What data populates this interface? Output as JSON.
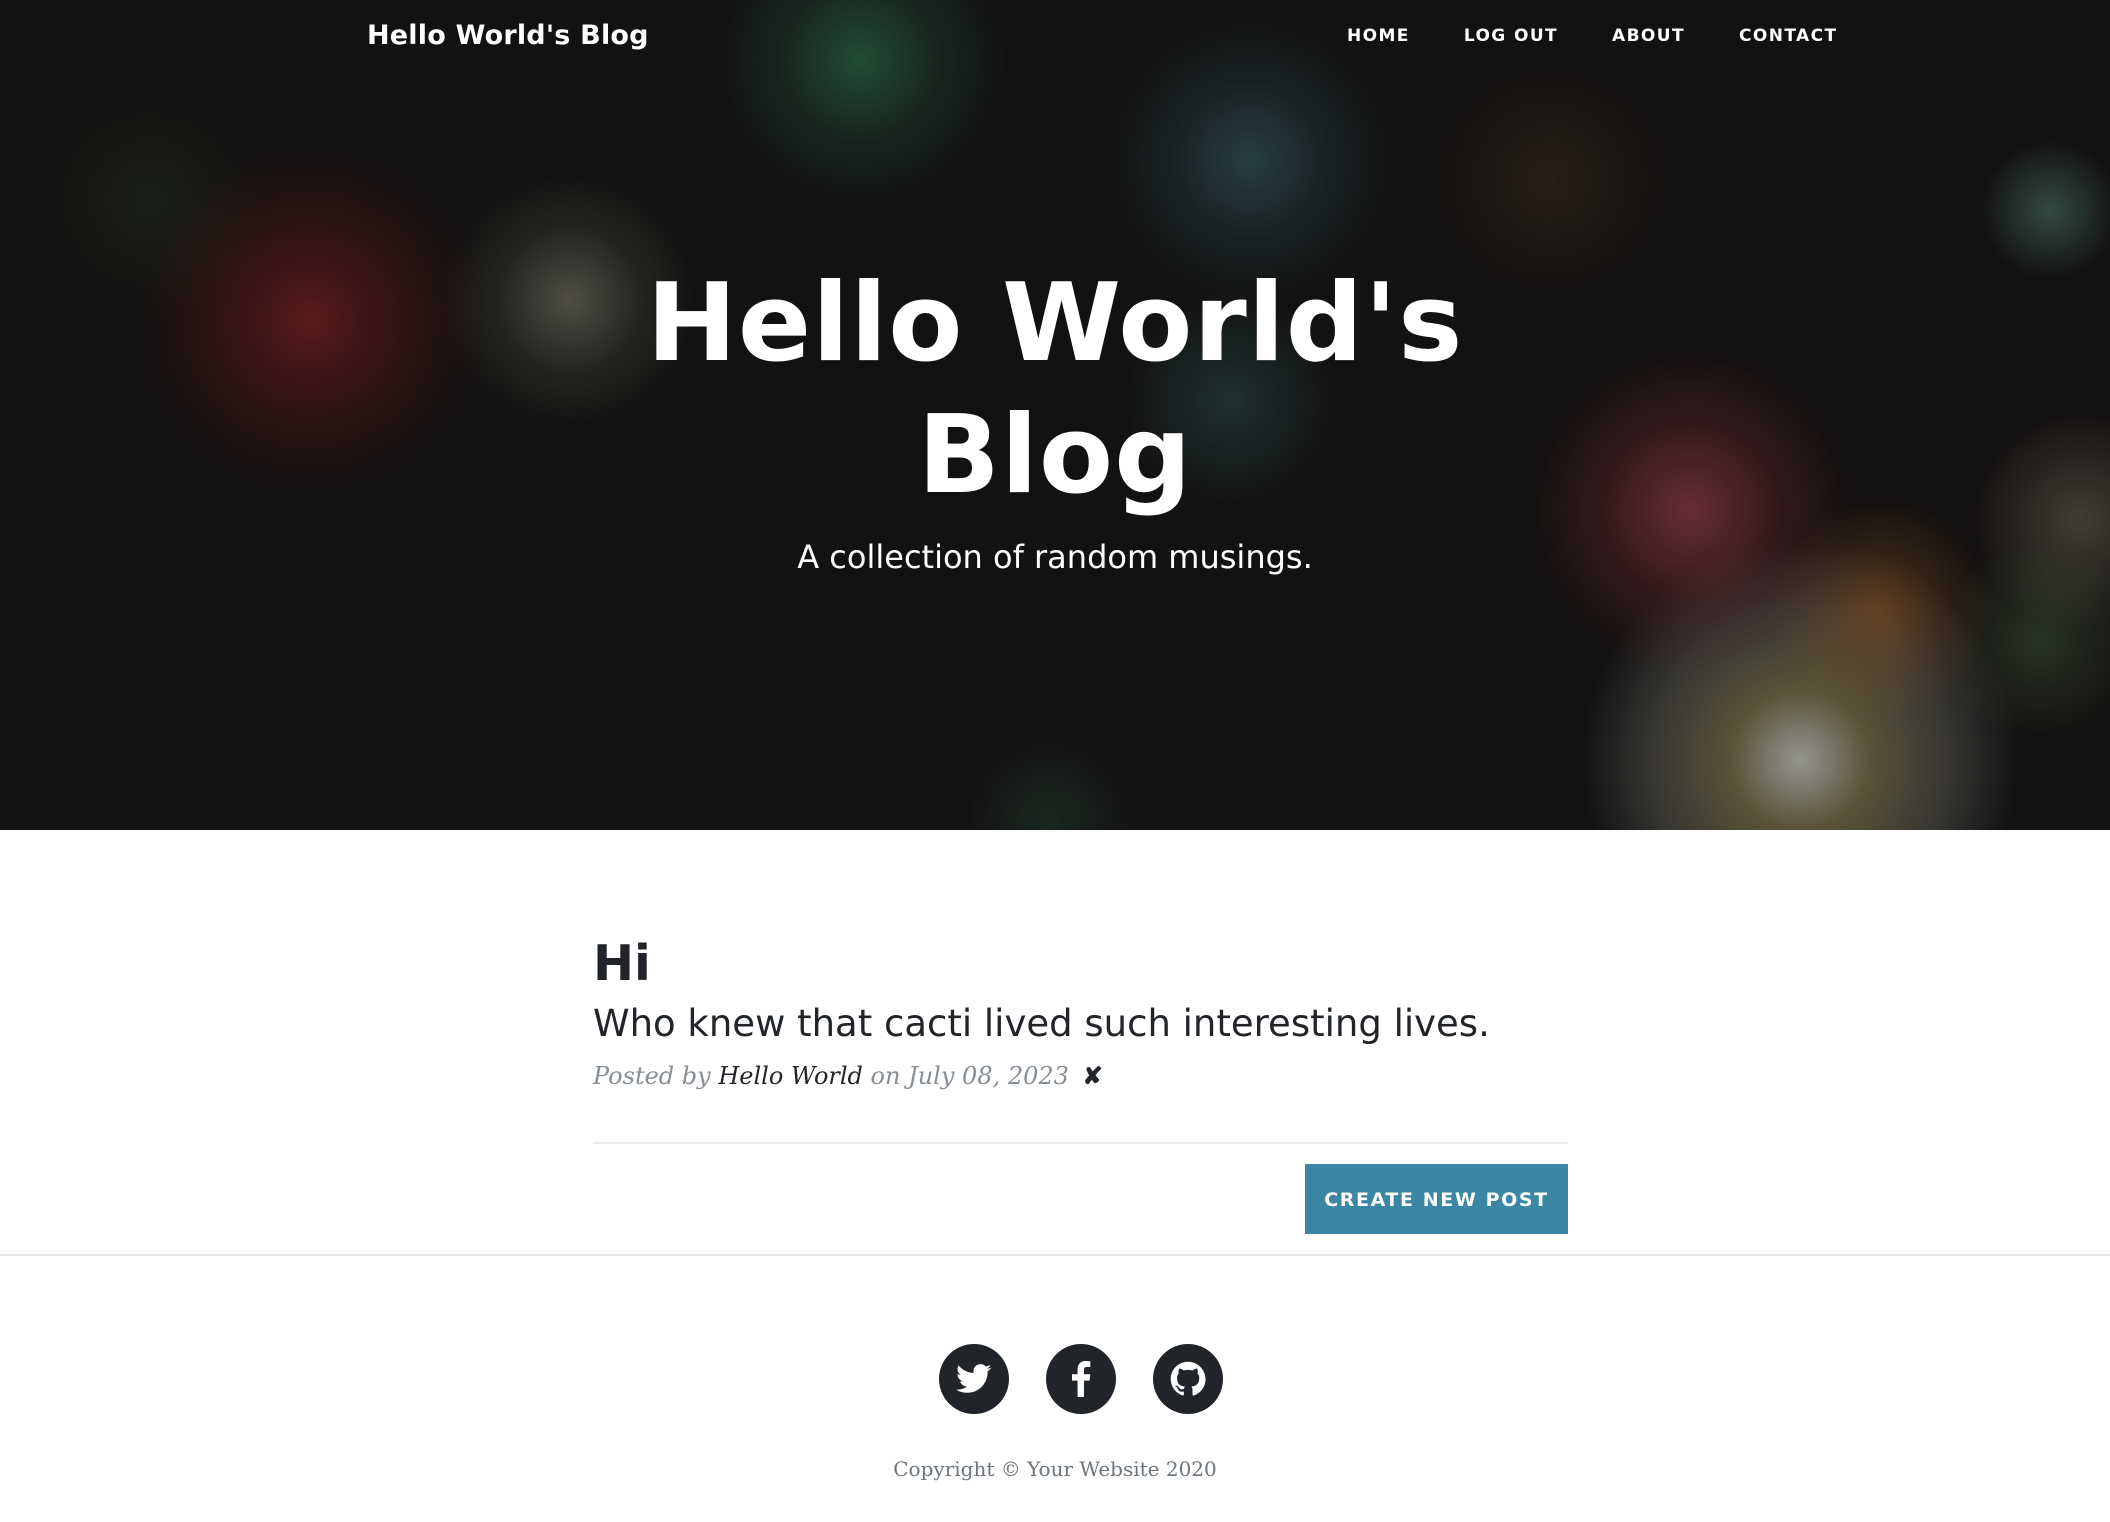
{
  "nav": {
    "brand": "Hello World's Blog",
    "links": [
      "HOME",
      "LOG OUT",
      "ABOUT",
      "CONTACT"
    ]
  },
  "hero": {
    "title": "Hello World's Blog",
    "subtitle": "A collection of random musings."
  },
  "post": {
    "title": "Hi",
    "subtitle": "Who knew that cacti lived such interesting lives.",
    "posted_by_prefix": "Posted by",
    "author": "Hello World",
    "date_prefix": "on",
    "date": "July 08, 2023",
    "delete_symbol": "✘"
  },
  "actions": {
    "create_new_post": "CREATE NEW POST"
  },
  "footer": {
    "social_icons": [
      "twitter-icon",
      "facebook-icon",
      "github-icon"
    ],
    "copyright": "Copyright © Your Website 2020"
  },
  "colors": {
    "accent": "#3a86a4",
    "text_dark": "#212529",
    "text_muted": "#868e96"
  }
}
